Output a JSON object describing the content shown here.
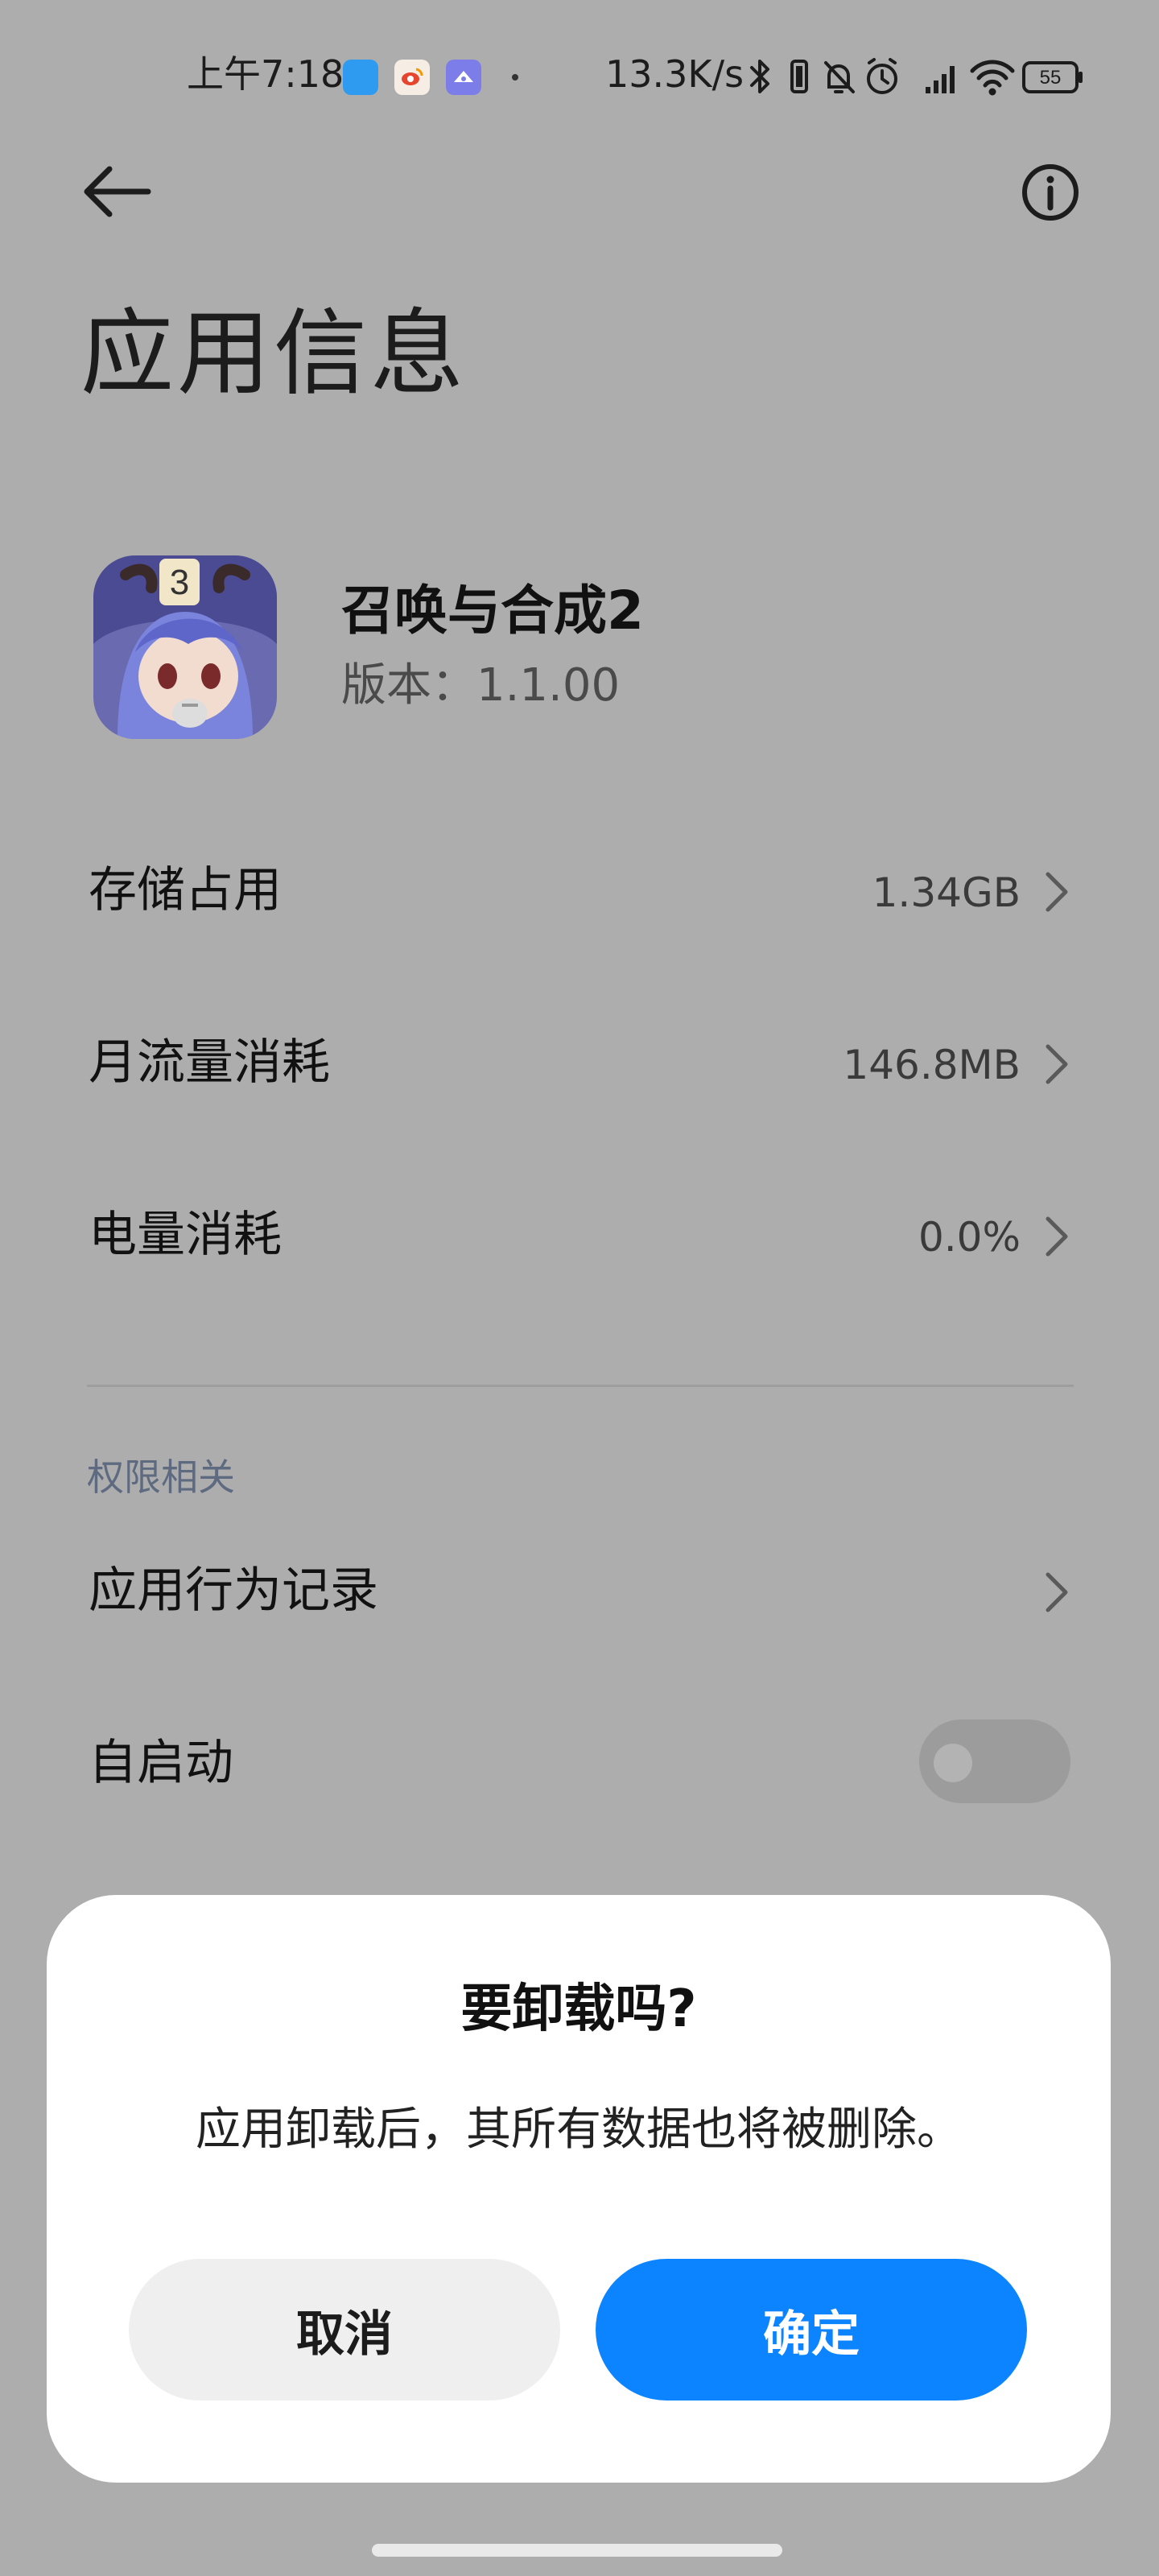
{
  "status_bar": {
    "time": "上午7:18",
    "net_speed": "13.3K/s",
    "battery": "55",
    "icons": [
      "bluetooth-icon",
      "vibrate-icon",
      "mute-icon",
      "alarm-icon",
      "signal-icon",
      "wifi-icon",
      "battery-icon"
    ]
  },
  "header": {
    "back_icon": "arrow-left-icon",
    "info_icon": "info-icon",
    "title": "应用信息"
  },
  "app": {
    "name": "召唤与合成2",
    "version": "版本：1.1.00",
    "icon_badge": "3"
  },
  "rows": [
    {
      "label": "存储占用",
      "value": "1.34GB"
    },
    {
      "label": "月流量消耗",
      "value": "146.8MB"
    },
    {
      "label": "电量消耗",
      "value": "0.0%"
    }
  ],
  "permissions": {
    "section_label": "权限相关",
    "behavior_label": "应用行为记录",
    "autostart_label": "自启动",
    "autostart_enabled": false
  },
  "dialog": {
    "title": "要卸载吗?",
    "message": "应用卸载后，其所有数据也将被删除。",
    "cancel_label": "取消",
    "confirm_label": "确定"
  },
  "colors": {
    "overlay_bg": "#adadad",
    "accent": "#0d84ff",
    "dialog_bg": "#ffffff",
    "section_label": "#5d6a80"
  }
}
